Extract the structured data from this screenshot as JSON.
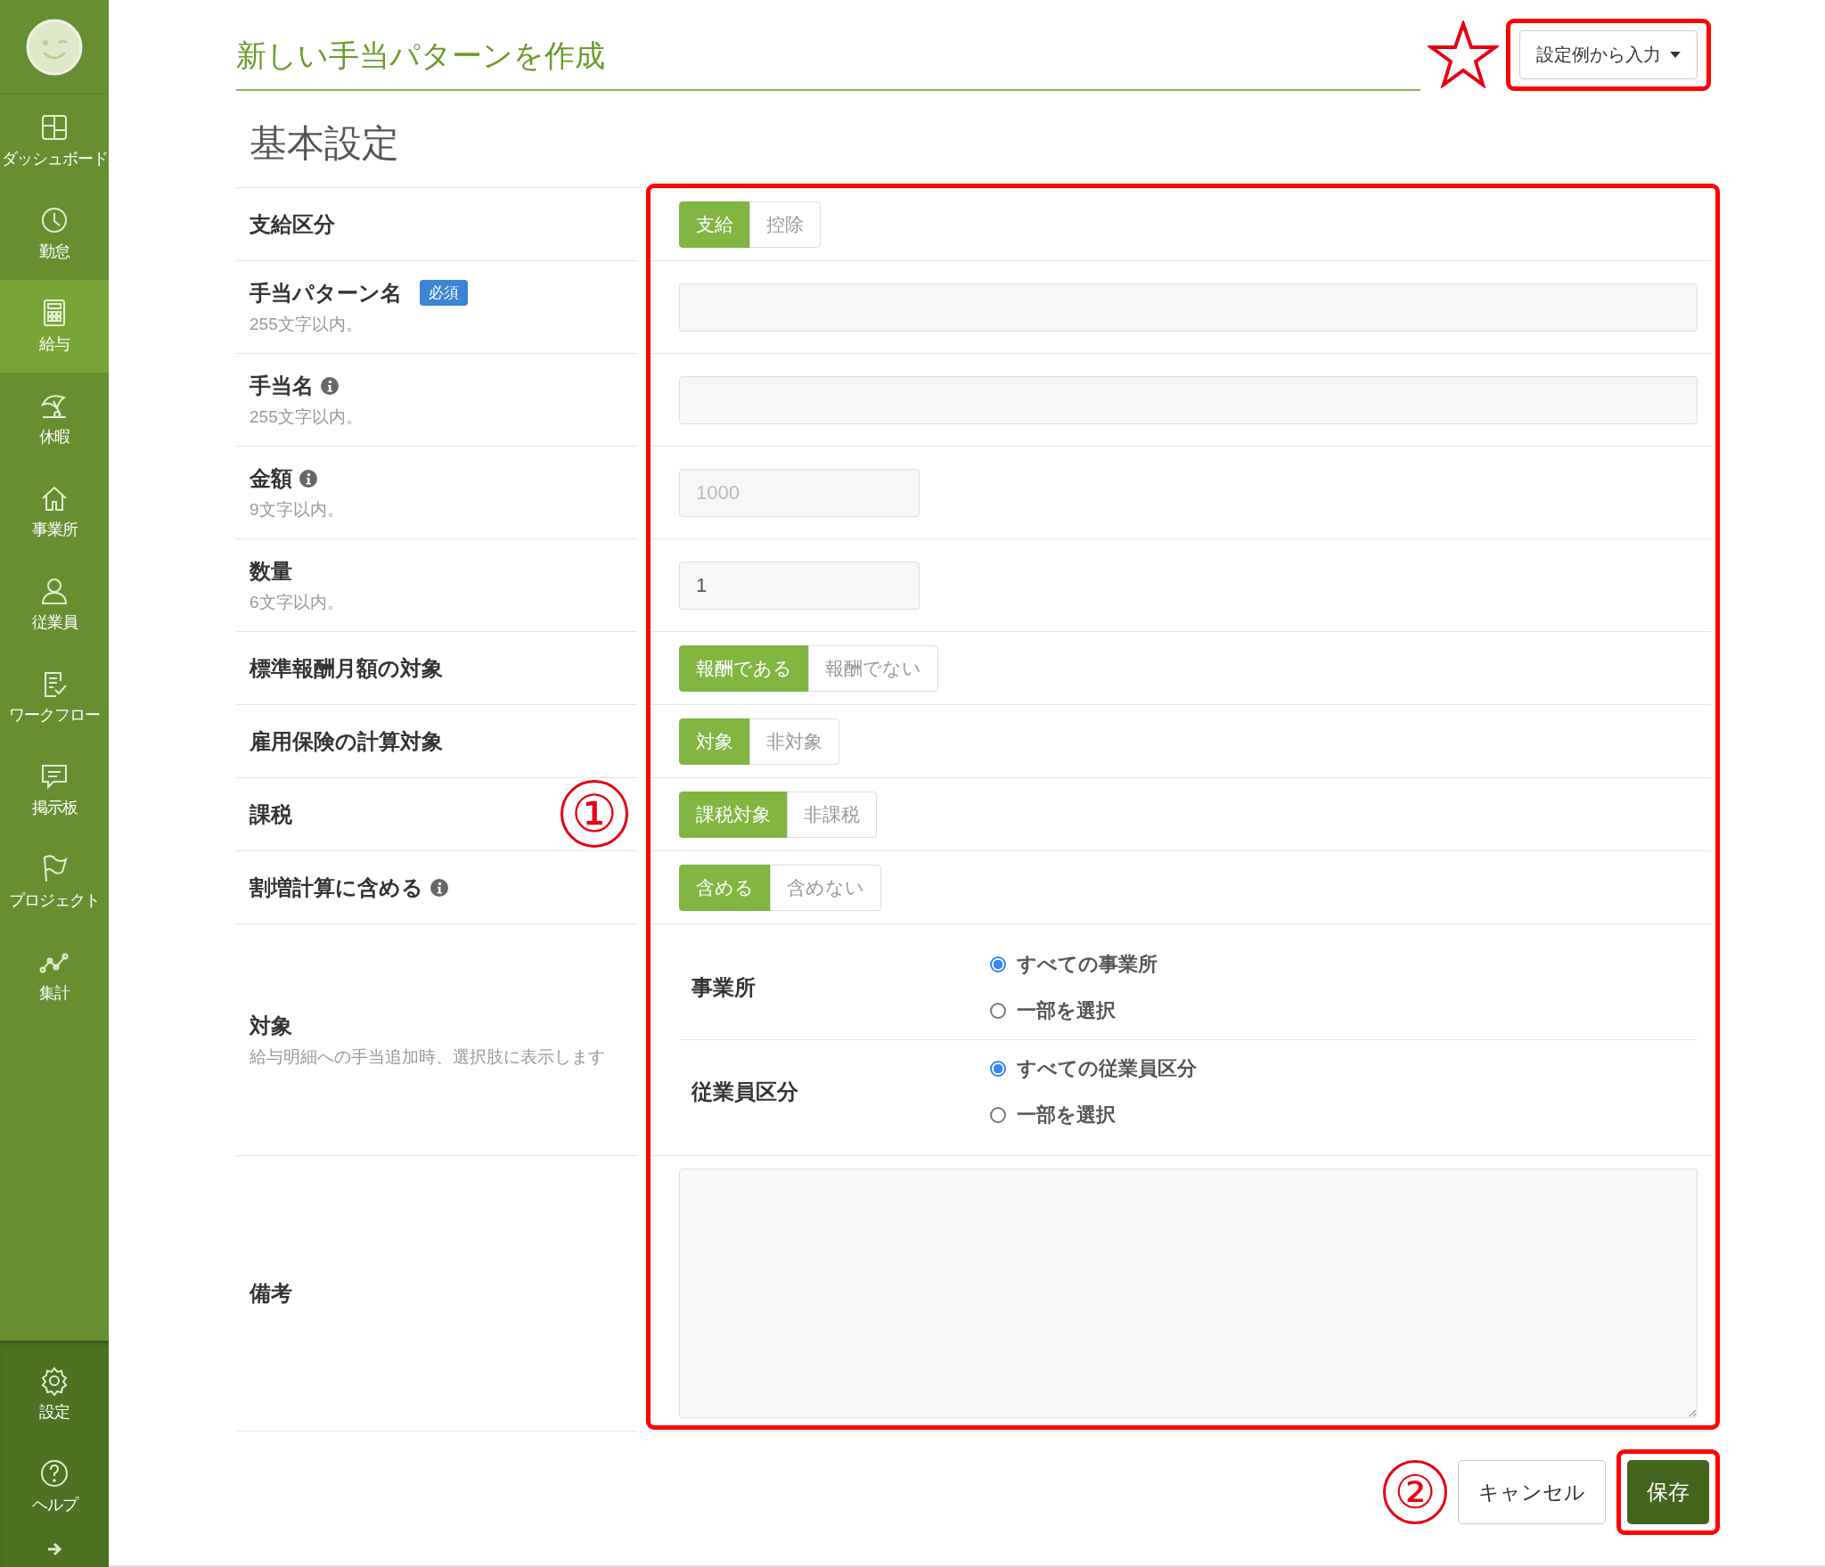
{
  "sidebar": {
    "items": [
      {
        "label": "ダッシュボード",
        "selected": false
      },
      {
        "label": "勤怠",
        "selected": false
      },
      {
        "label": "給与",
        "selected": true
      },
      {
        "label": "休暇",
        "selected": false
      },
      {
        "label": "事業所",
        "selected": false
      },
      {
        "label": "従業員",
        "selected": false
      },
      {
        "label": "ワークフロー",
        "selected": false
      },
      {
        "label": "掲示板",
        "selected": false
      },
      {
        "label": "プロジェクト",
        "selected": false
      },
      {
        "label": "集計",
        "selected": false
      }
    ],
    "bottom_items": [
      {
        "label": "設定"
      },
      {
        "label": "ヘルプ"
      }
    ]
  },
  "header": {
    "title": "新しい手当パターンを作成",
    "preset_button": "設定例から入力"
  },
  "section_title": "基本設定",
  "rows": [
    {
      "kind": "segmented",
      "label": "支給区分",
      "options": [
        {
          "label": "支給",
          "selected": true
        },
        {
          "label": "控除",
          "selected": false
        }
      ]
    },
    {
      "kind": "text",
      "label": "手当パターン名",
      "badge": "必須",
      "hint": "255文字以内。",
      "value": ""
    },
    {
      "kind": "text",
      "label": "手当名",
      "info": true,
      "hint": "255文字以内。",
      "value": ""
    },
    {
      "kind": "short",
      "label": "金額",
      "info": true,
      "hint": "9文字以内。",
      "placeholder": "1000"
    },
    {
      "kind": "short",
      "label": "数量",
      "hint": "6文字以内。",
      "value": "1"
    },
    {
      "kind": "segmented",
      "label": "標準報酬月額の対象",
      "options": [
        {
          "label": "報酬である",
          "selected": true
        },
        {
          "label": "報酬でない",
          "selected": false
        }
      ]
    },
    {
      "kind": "segmented",
      "label": "雇用保険の計算対象",
      "options": [
        {
          "label": "対象",
          "selected": true
        },
        {
          "label": "非対象",
          "selected": false
        }
      ]
    },
    {
      "kind": "segmented",
      "label": "課税",
      "annotation": "①",
      "options": [
        {
          "label": "課税対象",
          "selected": true
        },
        {
          "label": "非課税",
          "selected": false
        }
      ]
    },
    {
      "kind": "segmented",
      "label": "割増計算に含める",
      "info": true,
      "options": [
        {
          "label": "含める",
          "selected": true
        },
        {
          "label": "含めない",
          "selected": false
        }
      ]
    },
    {
      "kind": "radios",
      "label": "対象",
      "hint": "給与明細への手当追加時、選択肢に表示します",
      "groups": [
        {
          "label": "事業所",
          "options": [
            {
              "label": "すべての事業所",
              "selected": true
            },
            {
              "label": "一部を選択",
              "selected": false
            }
          ]
        },
        {
          "label": "従業員区分",
          "options": [
            {
              "label": "すべての従業員区分",
              "selected": true
            },
            {
              "label": "一部を選択",
              "selected": false
            }
          ]
        }
      ]
    },
    {
      "kind": "textarea",
      "label": "備考",
      "value": ""
    }
  ],
  "actions": {
    "cancel": "キャンセル",
    "save": "保存",
    "annotation": "②"
  }
}
